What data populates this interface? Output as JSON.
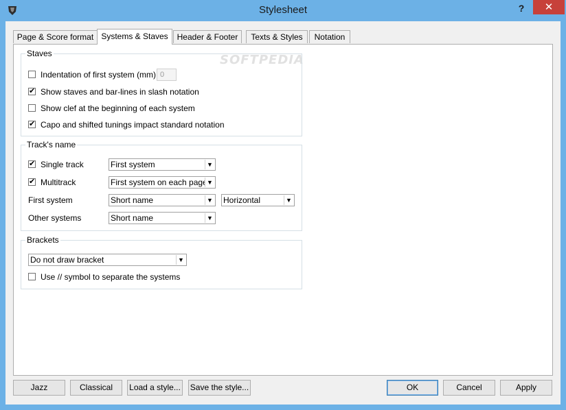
{
  "window": {
    "title": "Stylesheet",
    "help_label": "?",
    "close_label": "✕",
    "watermark": "SOFTPEDIA"
  },
  "tabs": [
    {
      "label": "Page & Score format"
    },
    {
      "label": "Systems & Staves",
      "active": true
    },
    {
      "label": "Header & Footer"
    },
    {
      "label": "Texts & Styles"
    },
    {
      "label": "Notation"
    }
  ],
  "staves": {
    "group_label": "Staves",
    "indentation": {
      "label": "Indentation of first system (mm)",
      "checked": false,
      "value": "0"
    },
    "slash_notation": {
      "label": "Show staves and bar-lines in slash notation",
      "checked": true
    },
    "show_clef": {
      "label": "Show clef at the beginning of each system",
      "checked": false
    },
    "capo": {
      "label": "Capo and shifted tunings impact standard notation",
      "checked": true
    }
  },
  "tracks_name": {
    "group_label": "Track's name",
    "single_track": {
      "label": "Single track",
      "checked": true,
      "value": "First system"
    },
    "multitrack": {
      "label": "Multitrack",
      "checked": true,
      "value": "First system on each page"
    },
    "first_system": {
      "label": "First system",
      "value": "Short name",
      "orientation": "Horizontal"
    },
    "other_systems": {
      "label": "Other systems",
      "value": "Short name"
    }
  },
  "brackets": {
    "group_label": "Brackets",
    "value": "Do not draw bracket",
    "use_symbol": {
      "label": "Use // symbol to separate the systems",
      "checked": false
    }
  },
  "buttons": {
    "jazz": "Jazz",
    "classical": "Classical",
    "load": "Load a style...",
    "save": "Save the style...",
    "ok": "OK",
    "cancel": "Cancel",
    "apply": "Apply"
  },
  "check_mark": "✔",
  "combo_arrow": "▼"
}
